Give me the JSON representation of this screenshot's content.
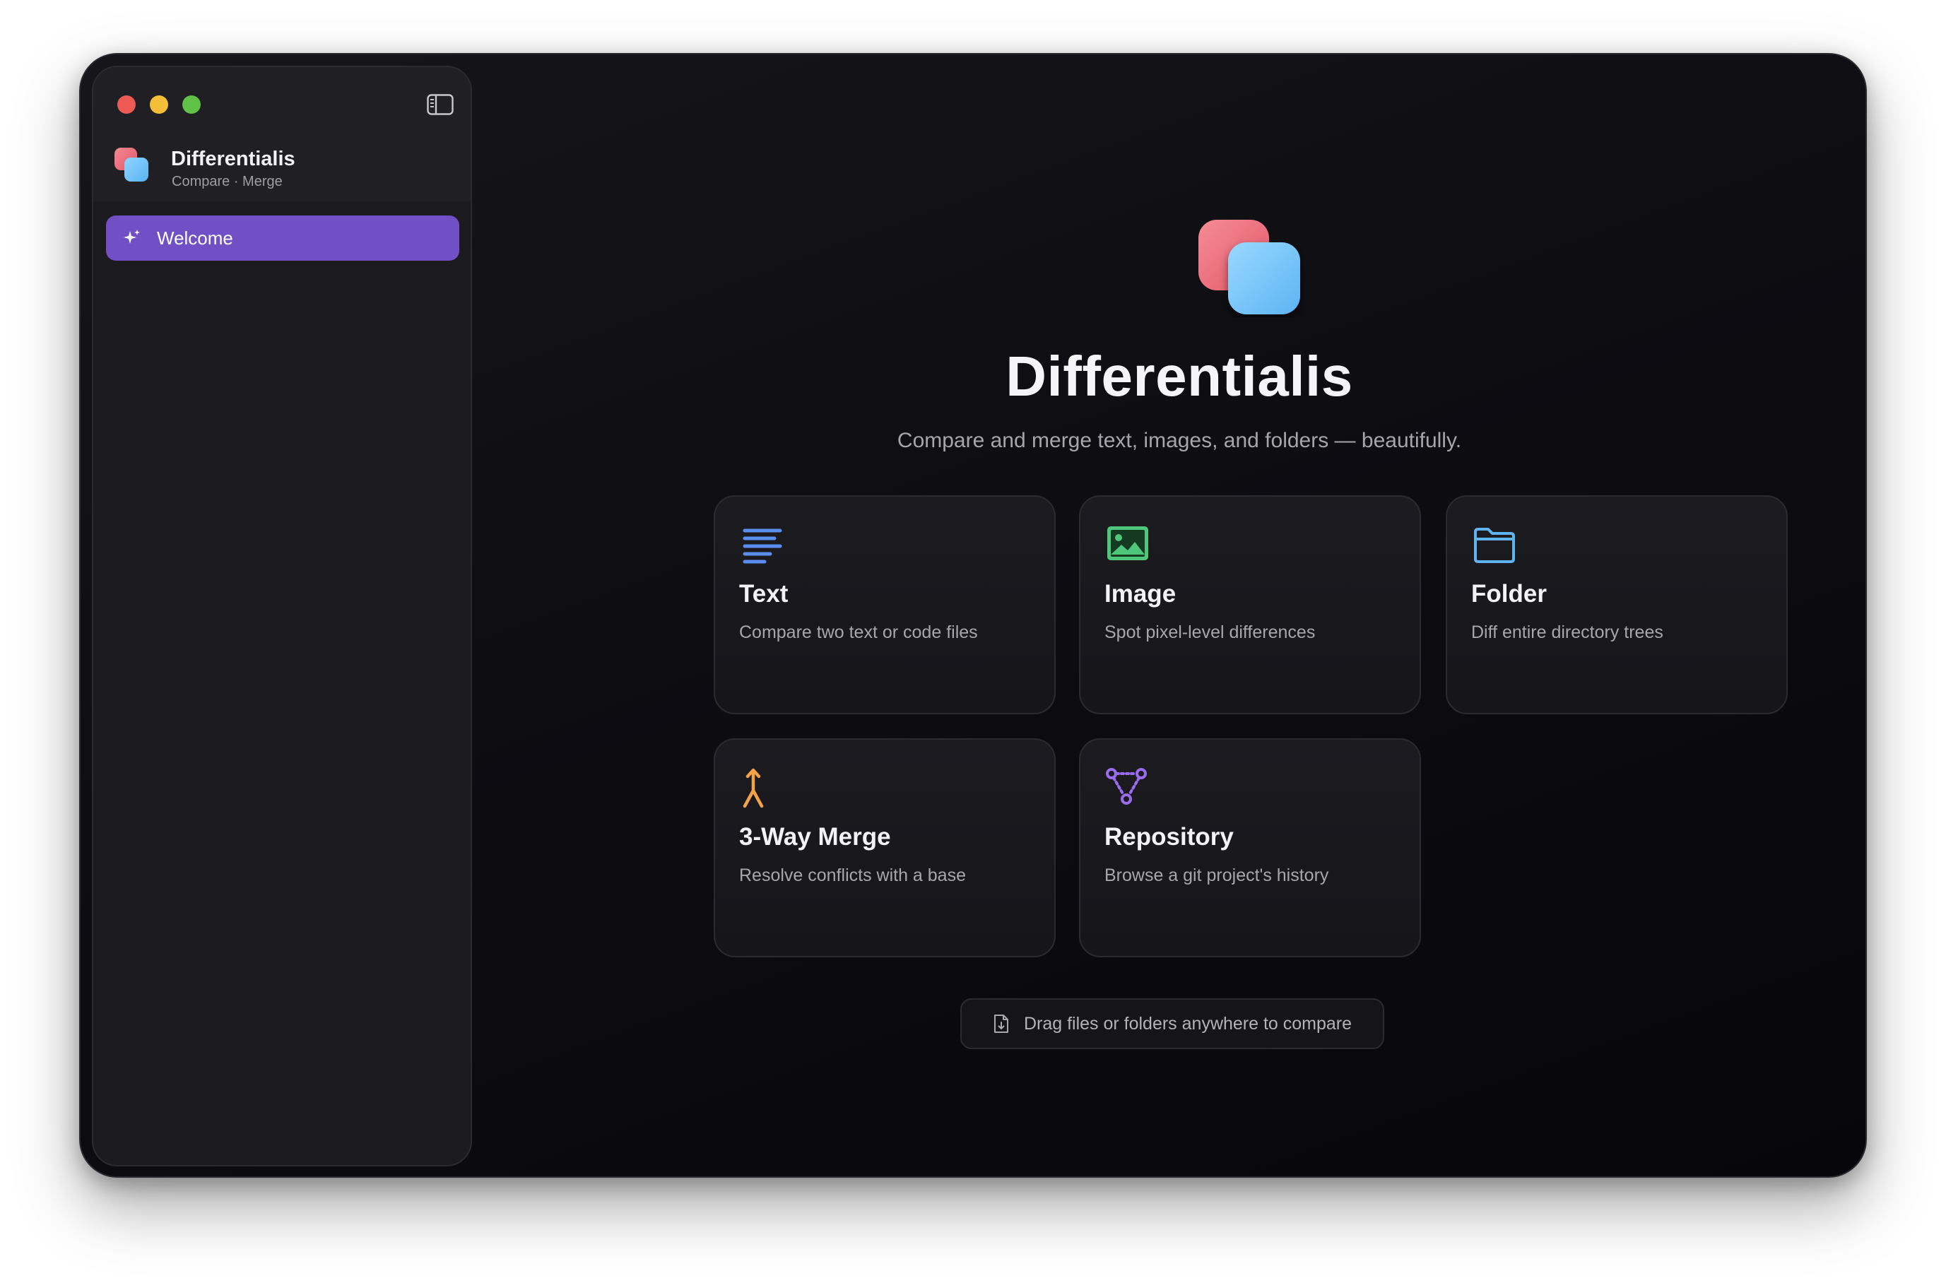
{
  "app": {
    "name": "Differentialis",
    "subtitle": "Compare · Merge"
  },
  "sidebar": {
    "items": [
      {
        "label": "Welcome",
        "icon": "sparkle-icon",
        "selected": true
      }
    ]
  },
  "hero": {
    "title": "Differentialis",
    "subtitle": "Compare and merge text, images, and folders — beautifully."
  },
  "cards": [
    {
      "title": "Text",
      "description": "Compare two text or code files",
      "icon": "text-lines-icon",
      "color": "#5b8def"
    },
    {
      "title": "Image",
      "description": "Spot pixel-level differences",
      "icon": "image-icon",
      "color": "#4ec77a"
    },
    {
      "title": "Folder",
      "description": "Diff entire directory trees",
      "icon": "folder-icon",
      "color": "#5fb4f0"
    },
    {
      "title": "3-Way Merge",
      "description": "Resolve conflicts with a base",
      "icon": "merge-icon",
      "color": "#f2a347"
    },
    {
      "title": "Repository",
      "description": "Browse a git project's history",
      "icon": "repository-icon",
      "color": "#9a6cf0"
    }
  ],
  "drop_hint": {
    "label": "Drag files or folders anywhere to compare",
    "icon": "document-icon"
  },
  "colors": {
    "accent": "#7050c4",
    "logo_pink": "#f0707e",
    "logo_blue": "#6fc3f7"
  }
}
